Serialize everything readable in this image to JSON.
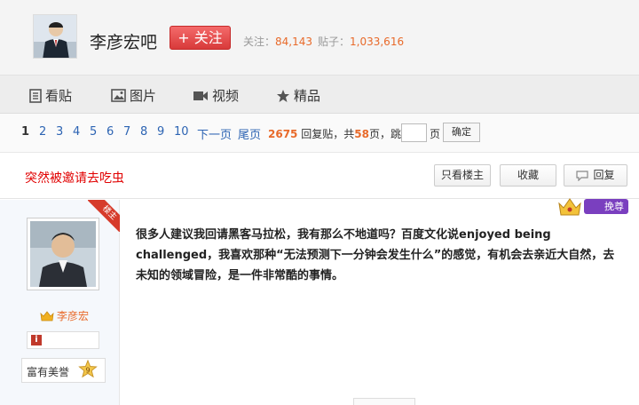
{
  "forum": {
    "name": "李彦宏吧",
    "follow_label": "+ 关注",
    "followers_label": "关注：",
    "followers_value": "84,143",
    "posts_label": "贴子：",
    "posts_value": "1,033,616"
  },
  "nav": {
    "tabs": [
      {
        "label": "看贴",
        "icon": "document-icon"
      },
      {
        "label": "图片",
        "icon": "image-icon"
      },
      {
        "label": "视频",
        "icon": "video-icon"
      },
      {
        "label": "精品",
        "icon": "star-icon"
      }
    ]
  },
  "pager": {
    "pages": [
      "1",
      "2",
      "3",
      "4",
      "5",
      "6",
      "7",
      "8",
      "9",
      "10"
    ],
    "current": "1",
    "next_label": "下一页",
    "last_label": "尾页",
    "reply_count": "2675",
    "reply_suffix": "回复贴，共",
    "page_count": "58",
    "page_suffix": "页，跳到",
    "page_unit": "页",
    "confirm_label": "确定"
  },
  "thread": {
    "title": "突然被邀请去吃虫",
    "only_op_label": "只看楼主",
    "favorite_label": "收藏",
    "reply_label": "回复"
  },
  "author": {
    "name": "李彦宏",
    "level_title": "富有美誉",
    "level_number": "9",
    "op_badge": "楼主",
    "info_icon_glyph": "i"
  },
  "post": {
    "text": "很多人建议我回请黑客马拉松，我有那么不地道吗？百度文化说enjoyed being challenged，我喜欢那种“无法预测下一分钟会发生什么”的感觉，有机会去亲近大自然，去未知的领域冒险，是一件非常酷的事情。",
    "vip_label": "挽尊"
  },
  "colors": {
    "accent_orange": "#e86a2a",
    "follow_red": "#d83a3a",
    "title_red": "#e10000",
    "link_blue": "#2d64b3",
    "vip_purple": "#7a3fbf"
  }
}
